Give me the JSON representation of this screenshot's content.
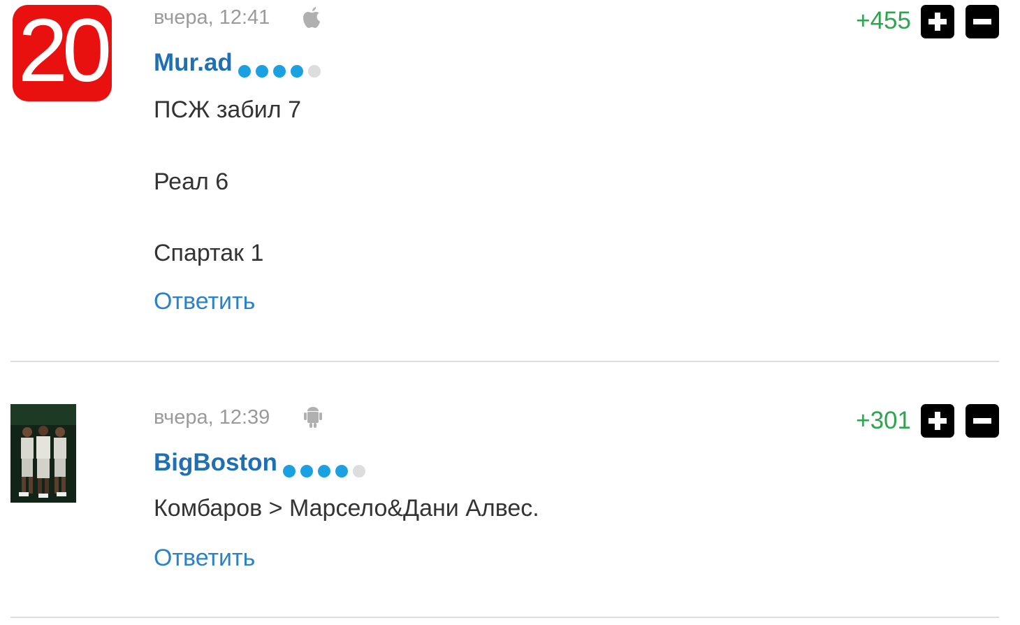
{
  "comments": [
    {
      "timestamp": "вчера, 12:41",
      "device_icon": "apple-icon",
      "author": "Mur.ad",
      "rating_dots": {
        "filled": 4,
        "total": 5
      },
      "avatar_text": "20",
      "avatar_color": "#e8110f",
      "score": "+455",
      "lines": [
        "ПСЖ забил 7",
        "Реал 6",
        "Спартак 1"
      ],
      "reply_label": "Ответить"
    },
    {
      "timestamp": "вчера, 12:39",
      "device_icon": "android-icon",
      "author": "BigBoston",
      "rating_dots": {
        "filled": 4,
        "total": 5
      },
      "avatar_image": "team-photo",
      "score": "+301",
      "lines": [
        "Комбаров > Марсело&Дани Алвес."
      ],
      "reply_label": "Ответить"
    }
  ],
  "colors": {
    "author": "#1f6fb5",
    "score": "#2ea44f",
    "reply": "#2b82c9",
    "rating_dot": "#1ba1e2",
    "rating_dot_off": "#dddddd"
  }
}
